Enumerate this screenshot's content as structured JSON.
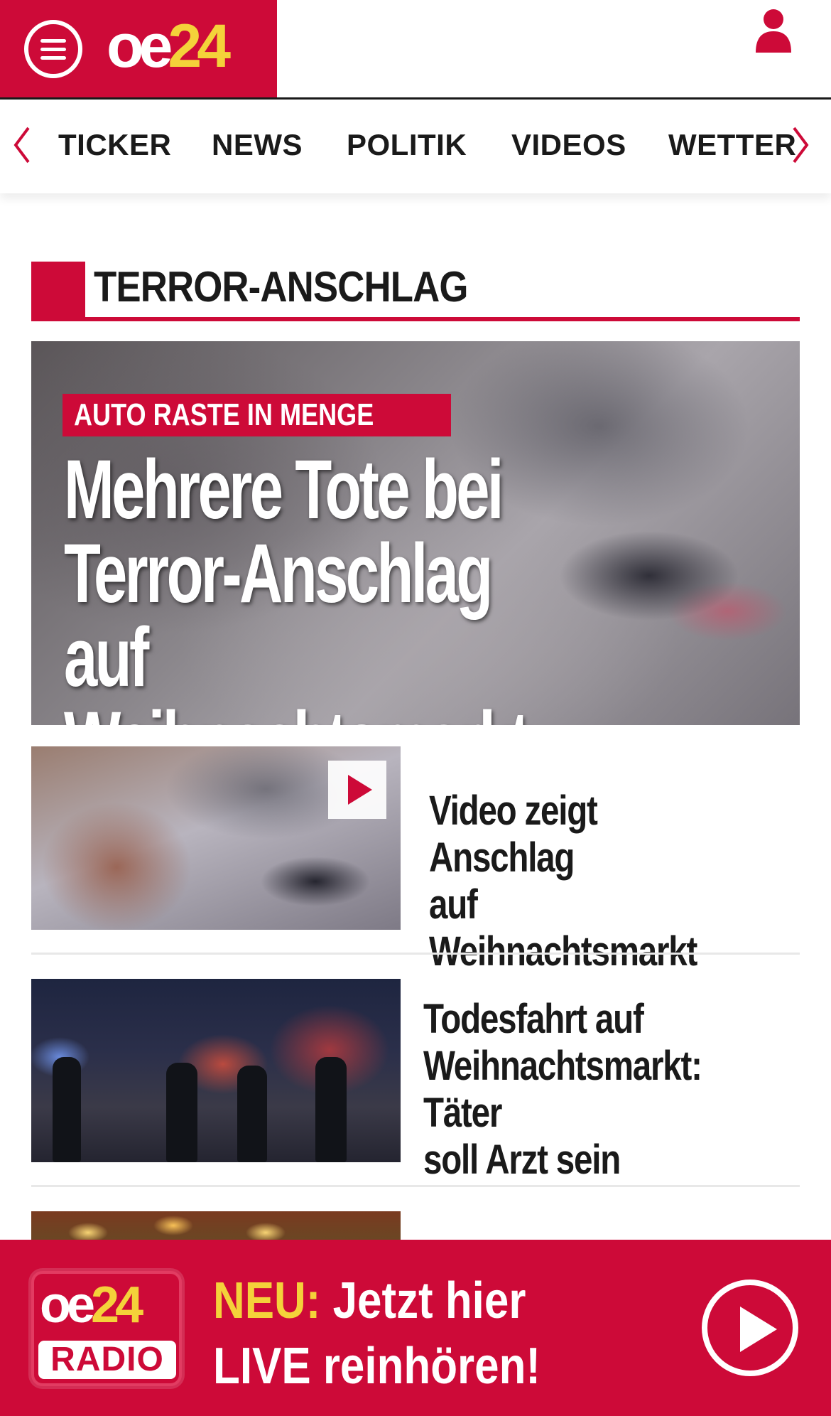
{
  "header": {
    "logo": {
      "part1": "oe",
      "part2": "24"
    },
    "menu_icon": "hamburger-menu-icon",
    "user_icon": "user-account-icon"
  },
  "nav": {
    "items": [
      {
        "label": "TICKER"
      },
      {
        "label": "NEWS"
      },
      {
        "label": "POLITIK"
      },
      {
        "label": "VIDEOS"
      },
      {
        "label": "WETTER"
      }
    ]
  },
  "section": {
    "title": "TERROR-ANSCHLAG"
  },
  "hero": {
    "kicker": "AUTO RASTE IN MENGE",
    "headline_line1": "Mehrere Tote bei",
    "headline_line2": "Terror-Anschlag",
    "headline_line3": "auf Weihnachtsmarkt"
  },
  "articles": [
    {
      "title_line1": "Video zeigt Anschlag",
      "title_line2": "auf Weihnachtsmarkt",
      "title_line3": "",
      "has_video": true
    },
    {
      "title_line1": "Todesfahrt auf",
      "title_line2": "Weihnachtsmarkt: Täter",
      "title_line3": "soll Arzt sein",
      "has_video": false
    }
  ],
  "radio": {
    "logo_top_part1": "oe",
    "logo_top_part2": "24",
    "logo_bottom": "RADIO",
    "highlight": "NEU:",
    "text_line1": "Jetzt hier",
    "text_line2": "LIVE reinhören!"
  },
  "colors": {
    "brand_red": "#cd0a38",
    "brand_yellow": "#f4d23a",
    "text_dark": "#1a1a1a"
  }
}
